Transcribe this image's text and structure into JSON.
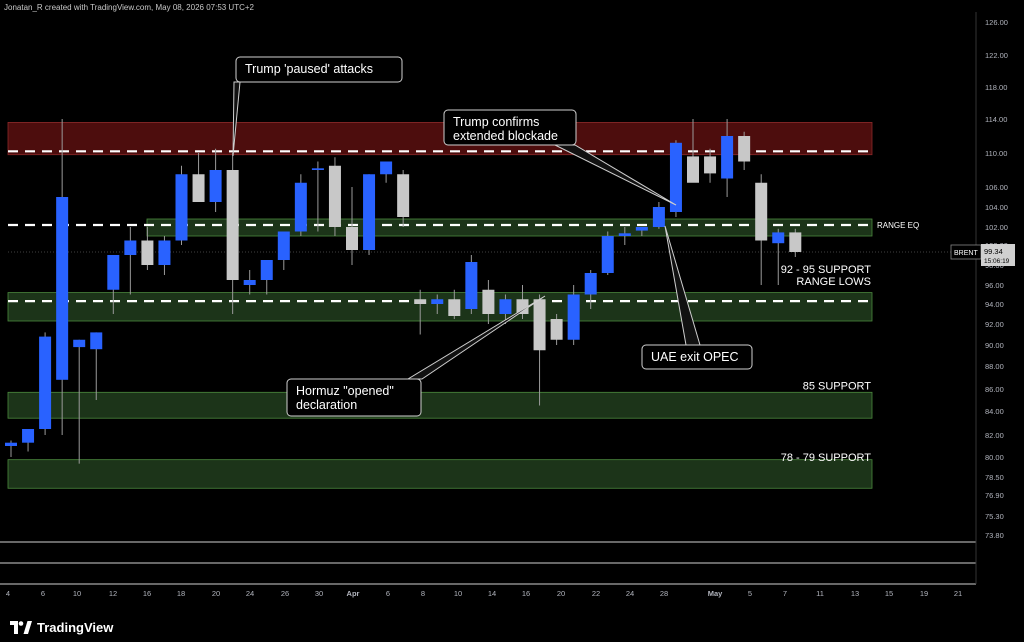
{
  "header": {
    "text": "Jonatan_R created with TradingView.com, May 08, 2026 07:53 UTC+2"
  },
  "footer": {
    "brand": "TradingView",
    "logo_icon": "tradingview-logo-icon"
  },
  "colors": {
    "up": "#2962ff",
    "down": "#c8c8c8",
    "up_hi": "#3d5ff0",
    "resistance_zone": "#5a0f0f",
    "support_zone": "#1f3a1c",
    "zone_border": "#4c8a3e",
    "annotation_border": "#cfcfcf"
  },
  "chart_data": {
    "type": "candlestick",
    "symbol": "BRENT",
    "last_price": "99.34",
    "countdown": "15:06:19",
    "y_ticks": [
      "126.00",
      "122.00",
      "118.00",
      "114.00",
      "110.00",
      "106.00",
      "104.00",
      "102.00",
      "100.00",
      "98.00",
      "96.00",
      "94.00",
      "92.00",
      "90.00",
      "88.00",
      "86.00",
      "84.00",
      "82.00",
      "80.00",
      "78.50",
      "76.90",
      "75.30",
      "73.80"
    ],
    "x_ticks": [
      "4",
      "6",
      "10",
      "12",
      "16",
      "18",
      "20",
      "24",
      "26",
      "30",
      "Apr",
      "6",
      "8",
      "10",
      "14",
      "16",
      "20",
      "22",
      "24",
      "28",
      "May",
      "5",
      "7",
      "11",
      "13",
      "15",
      "19",
      "21"
    ],
    "zones": [
      {
        "type": "resistance",
        "top": 113.6,
        "bottom": 109.8
      },
      {
        "type": "range_eq",
        "top": 102.8,
        "bottom": 101.0
      },
      {
        "type": "support",
        "top": 95.2,
        "bottom": 92.3
      },
      {
        "type": "support",
        "top": 85.7,
        "bottom": 83.4
      },
      {
        "type": "support",
        "top": 79.8,
        "bottom": 77.5
      }
    ],
    "dashed_levels": [
      110.2,
      102.2,
      94.3
    ],
    "labels": [
      {
        "text": "RANGE EQ",
        "price": 102.2
      },
      {
        "text": "92 - 95 SUPPORT",
        "price": 97.6
      },
      {
        "text": "RANGE LOWS",
        "price": 96.4
      },
      {
        "text": "85 SUPPORT",
        "price": 86.3
      },
      {
        "text": "78 - 79 SUPPORT",
        "price": 80.0
      }
    ],
    "annotations": [
      {
        "text": [
          "Trump 'paused' attacks"
        ]
      },
      {
        "text": [
          "Trump confirms",
          "extended blockade"
        ]
      },
      {
        "text": [
          "Hormuz \"opened\"",
          "declaration"
        ]
      },
      {
        "text": [
          "UAE exit OPEC"
        ]
      }
    ],
    "candles": [
      {
        "o": 81.0,
        "h": 81.5,
        "l": 80.0,
        "c": 81.3
      },
      {
        "o": 81.3,
        "h": 82.5,
        "l": 80.5,
        "c": 82.5
      },
      {
        "o": 82.5,
        "h": 91.2,
        "l": 82.0,
        "c": 90.8
      },
      {
        "o": 86.8,
        "h": 114.0,
        "l": 82.0,
        "c": 105.0
      },
      {
        "o": 89.8,
        "h": 90.5,
        "l": 79.5,
        "c": 90.5
      },
      {
        "o": 89.6,
        "h": 91.2,
        "l": 85.0,
        "c": 91.2
      },
      {
        "o": 95.5,
        "h": 98.5,
        "l": 93.0,
        "c": 99.0
      },
      {
        "o": 99.0,
        "h": 102.0,
        "l": 95.0,
        "c": 100.5
      },
      {
        "o": 100.5,
        "h": 102.0,
        "l": 97.5,
        "c": 98.0
      },
      {
        "o": 98.0,
        "h": 101.0,
        "l": 97.0,
        "c": 100.5
      },
      {
        "o": 100.5,
        "h": 108.5,
        "l": 100.0,
        "c": 107.5
      },
      {
        "o": 107.5,
        "h": 110.0,
        "l": 104.5,
        "c": 104.5
      },
      {
        "o": 104.5,
        "h": 110.5,
        "l": 103.5,
        "c": 108.0
      },
      {
        "o": 108.0,
        "h": 110.0,
        "l": 93.0,
        "c": 96.5
      },
      {
        "o": 96.0,
        "h": 97.5,
        "l": 95.0,
        "c": 96.5
      },
      {
        "o": 96.5,
        "h": 98.0,
        "l": 95.0,
        "c": 98.5
      },
      {
        "o": 98.5,
        "h": 101.5,
        "l": 97.5,
        "c": 101.5
      },
      {
        "o": 101.5,
        "h": 107.5,
        "l": 101.0,
        "c": 106.5
      },
      {
        "o": 108.0,
        "h": 109.0,
        "l": 101.5,
        "c": 108.2
      },
      {
        "o": 108.5,
        "h": 109.5,
        "l": 101.0,
        "c": 102.0
      },
      {
        "o": 102.0,
        "h": 106.0,
        "l": 98.0,
        "c": 99.5
      },
      {
        "o": 99.5,
        "h": 107.5,
        "l": 99.0,
        "c": 107.5
      },
      {
        "o": 107.5,
        "h": 109.0,
        "l": 106.5,
        "c": 109.0
      },
      {
        "o": 107.5,
        "h": 108.0,
        "l": 102.0,
        "c": 103.0
      },
      {
        "o": 94.5,
        "h": 95.5,
        "l": 91.0,
        "c": 94.0
      },
      {
        "o": 94.0,
        "h": 95.0,
        "l": 93.0,
        "c": 94.5
      },
      {
        "o": 94.5,
        "h": 95.5,
        "l": 92.5,
        "c": 92.8
      },
      {
        "o": 93.5,
        "h": 99.0,
        "l": 93.0,
        "c": 98.3
      },
      {
        "o": 95.5,
        "h": 96.5,
        "l": 92.0,
        "c": 93.0
      },
      {
        "o": 93.0,
        "h": 95.0,
        "l": 92.0,
        "c": 94.5
      },
      {
        "o": 94.5,
        "h": 96.0,
        "l": 92.5,
        "c": 93.0
      },
      {
        "o": 94.5,
        "h": 95.0,
        "l": 84.5,
        "c": 89.5
      },
      {
        "o": 92.5,
        "h": 93.0,
        "l": 90.0,
        "c": 90.5
      },
      {
        "o": 90.5,
        "h": 96.0,
        "l": 90.0,
        "c": 95.0
      },
      {
        "o": 95.0,
        "h": 97.5,
        "l": 93.5,
        "c": 97.2
      },
      {
        "o": 97.2,
        "h": 101.5,
        "l": 97.0,
        "c": 101.0
      },
      {
        "o": 101.0,
        "h": 102.0,
        "l": 100.0,
        "c": 101.3
      },
      {
        "o": 101.6,
        "h": 102.0,
        "l": 101.0,
        "c": 102.0
      },
      {
        "o": 102.0,
        "h": 104.5,
        "l": 101.8,
        "c": 104.0
      },
      {
        "o": 103.5,
        "h": 111.5,
        "l": 103.0,
        "c": 111.2
      },
      {
        "o": 109.6,
        "h": 114.0,
        "l": 107.0,
        "c": 106.5
      },
      {
        "o": 109.6,
        "h": 110.5,
        "l": 106.5,
        "c": 107.6
      },
      {
        "o": 107.0,
        "h": 114.0,
        "l": 105.0,
        "c": 112.0
      },
      {
        "o": 112.0,
        "h": 112.5,
        "l": 108.0,
        "c": 109.0
      },
      {
        "o": 106.5,
        "h": 107.5,
        "l": 96.0,
        "c": 100.5
      },
      {
        "o": 100.2,
        "h": 101.8,
        "l": 96.0,
        "c": 101.4
      },
      {
        "o": 101.4,
        "h": 101.8,
        "l": 98.8,
        "c": 99.3
      }
    ]
  }
}
